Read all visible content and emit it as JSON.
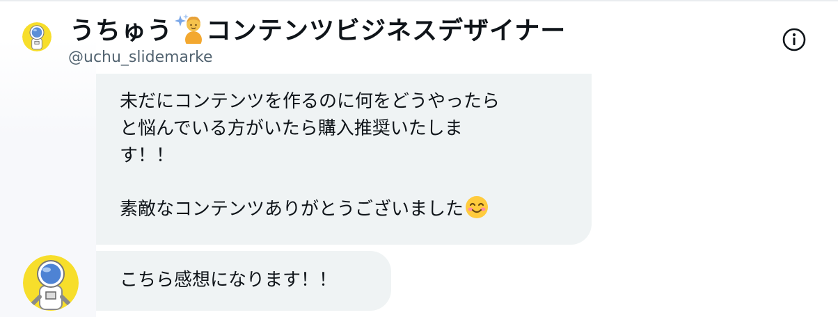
{
  "header": {
    "name_before": "うちゅう",
    "name_after": "コンテンツビジネスデザイナー",
    "handle": "@uchu_slidemarke",
    "name_icon": "sparkles-astronaut-emoji",
    "avatar_icon": "astronaut-avatar",
    "info_icon": "info-icon"
  },
  "messages": [
    {
      "lines": [
        "未だにコンテンツを作るのに何をどうやったら",
        "と悩んでいる方がいたら購入推奨いたしま",
        "す！！",
        "",
        "素敵なコンテンツありがとうございました"
      ],
      "trailing_emoji": "smiling-face-emoji"
    },
    {
      "lines": [
        "こちら感想になります！！"
      ],
      "sender_avatar": "astronaut-avatar"
    }
  ],
  "colors": {
    "bubble": "#eff3f4",
    "text": "#0f1419",
    "secondary_text": "#536471",
    "avatar_yellow": "#f7de2b"
  }
}
